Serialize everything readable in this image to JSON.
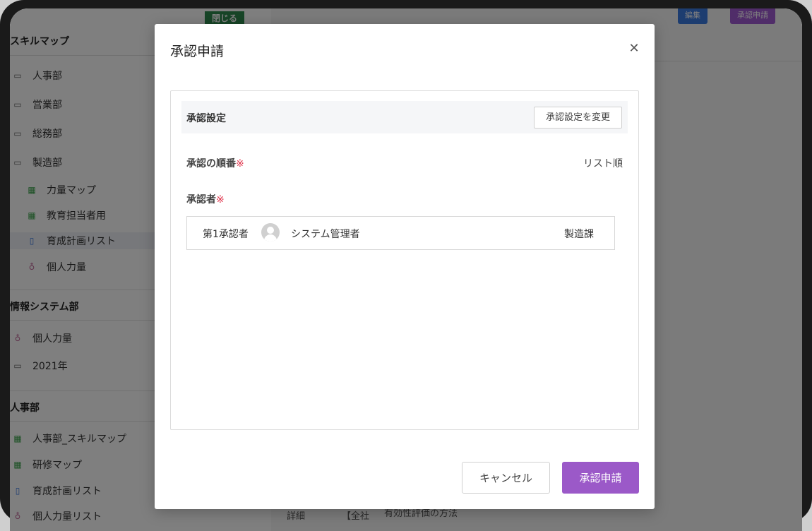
{
  "sidebar": {
    "sections": [
      {
        "title": "スキルマップ"
      },
      {
        "title": "情報システム部"
      },
      {
        "title": "人事部"
      }
    ],
    "items": [
      {
        "label": "人事部",
        "icon": "folder-icon"
      },
      {
        "label": "営業部",
        "icon": "folder-icon"
      },
      {
        "label": "総務部",
        "icon": "folder-icon"
      },
      {
        "label": "製造部",
        "icon": "folder-icon"
      },
      {
        "label": "力量マップ",
        "icon": "grid-icon"
      },
      {
        "label": "教育担当者用",
        "icon": "grid-icon"
      },
      {
        "label": "育成計画リスト",
        "icon": "book-icon"
      },
      {
        "label": "個人力量",
        "icon": "medal-icon"
      },
      {
        "label": "個人力量",
        "icon": "medal-icon"
      },
      {
        "label": "2021年",
        "icon": "folder-icon"
      },
      {
        "label": "人事部_スキルマップ",
        "icon": "grid-icon"
      },
      {
        "label": "研修マップ",
        "icon": "grid-icon"
      },
      {
        "label": "育成計画リスト",
        "icon": "book-icon"
      },
      {
        "label": "個人力量リスト",
        "icon": "medal-icon"
      }
    ]
  },
  "background": {
    "close_tag": "閉じる",
    "edit_button": "編集",
    "approval_button": "承認申請",
    "bottom_cells": [
      "詳細",
      "【全社",
      "有効性評価の方法"
    ]
  },
  "modal": {
    "title": "承認申請",
    "settings_label": "承認設定",
    "change_settings_button": "承認設定を変更",
    "order_label": "承認の順番",
    "required_mark": "※",
    "order_value": "リスト順",
    "approvers_label": "承認者",
    "approvers": [
      {
        "order": "第1承認者",
        "name": "システム管理者",
        "department": "製造課"
      }
    ],
    "cancel_button": "キャンセル",
    "submit_button": "承認申請"
  },
  "colors": {
    "submit": "#9b59c8",
    "required": "#e0334b",
    "close_tag": "#2e8b4e"
  }
}
